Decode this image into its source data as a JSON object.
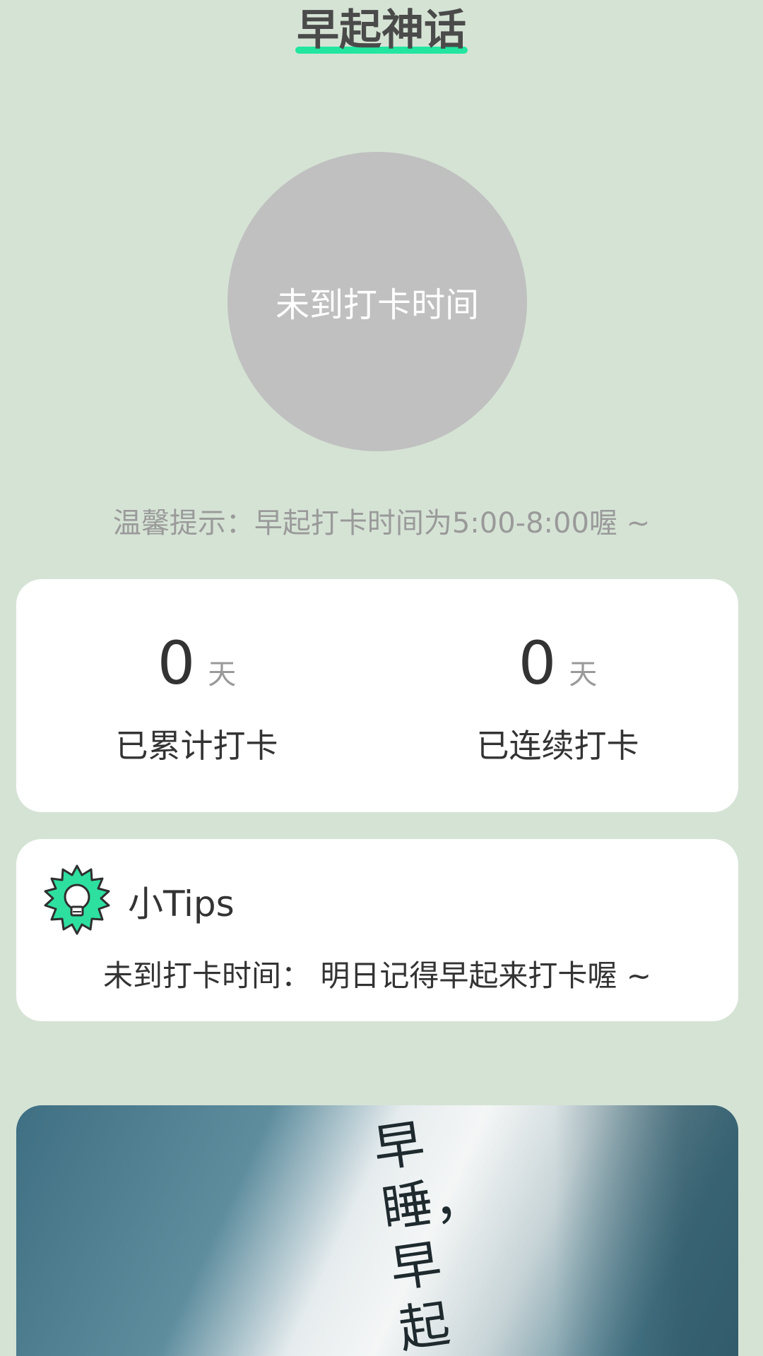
{
  "header": {
    "title": "早起神话"
  },
  "checkin": {
    "button_label": "未到打卡时间",
    "hint": "温馨提示：早起打卡时间为5:00-8:00喔 ~"
  },
  "stats": {
    "total": {
      "value": "0",
      "unit": "天",
      "label": "已累计打卡"
    },
    "streak": {
      "value": "0",
      "unit": "天",
      "label": "已连续打卡"
    }
  },
  "tips": {
    "icon": "lightbulb-badge-icon",
    "title": "小Tips",
    "text": "未到打卡时间：   明日记得早起来打卡喔 ~"
  },
  "photo": {
    "handwriting": "早\n睡，\n早起"
  },
  "colors": {
    "background": "#d5e3d5",
    "accent": "#22e6a0",
    "circle_inactive": "#c0c0c0",
    "card": "#ffffff"
  }
}
